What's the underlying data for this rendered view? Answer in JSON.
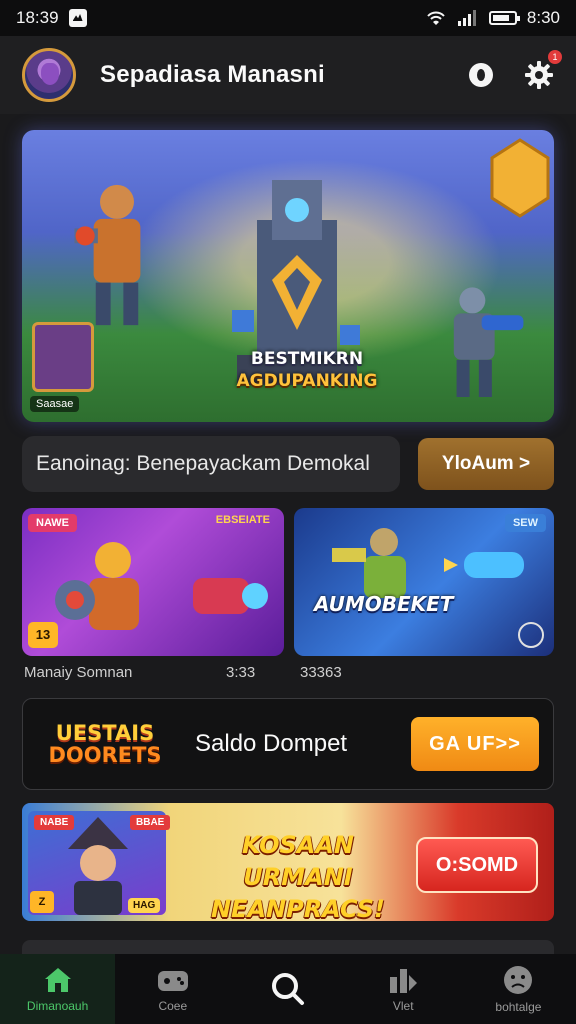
{
  "status_bar": {
    "time_left": "18:39",
    "time_right": "8:30"
  },
  "header": {
    "title": "Sepadiasa Manasni",
    "notification_count": "1"
  },
  "hero": {
    "caption_line1": "BESTMIKRN",
    "caption_line2": "AGDUPANKING",
    "card_label": "Saasae"
  },
  "search": {
    "placeholder": "Eanoinag: Benepayackam Demokal",
    "button_label": "YloAum >"
  },
  "tiles": [
    {
      "tag": "NAWE",
      "tag2": "EBSEIATE",
      "title": "",
      "corner": "13",
      "meta": "Manaiy Somnan",
      "meta2": "3:33"
    },
    {
      "tag": "SEW",
      "title": "AUMOBEKET",
      "meta": "33363"
    }
  ],
  "wallet": {
    "logo_line1": "UESTAIS",
    "logo_line2": "DOORETS",
    "label": "Saldo Dompet",
    "button_label": "GA UF>>"
  },
  "promo": {
    "tag1": "NABE",
    "tag2": "BBAE",
    "corner": "Z",
    "chip": "HAG",
    "title_line1": "KOSAAN URMANI",
    "title_line2": "NEANPRACS!",
    "button_label": "O:SOMD"
  },
  "bottom_nav": [
    {
      "label": "Dimanoauh",
      "icon": "home-icon",
      "active": true
    },
    {
      "label": "Coee",
      "icon": "controller-icon",
      "active": false
    },
    {
      "label": "",
      "icon": "search-icon",
      "active": false
    },
    {
      "label": "Vlet",
      "icon": "chart-icon",
      "active": false
    },
    {
      "label": "bohtalge",
      "icon": "profile-icon",
      "active": false
    }
  ],
  "colors": {
    "background": "#1a1a1c",
    "accent_orange": "#f08a14",
    "accent_gold": "#d59a3c",
    "nav_active": "#4cc86a"
  }
}
